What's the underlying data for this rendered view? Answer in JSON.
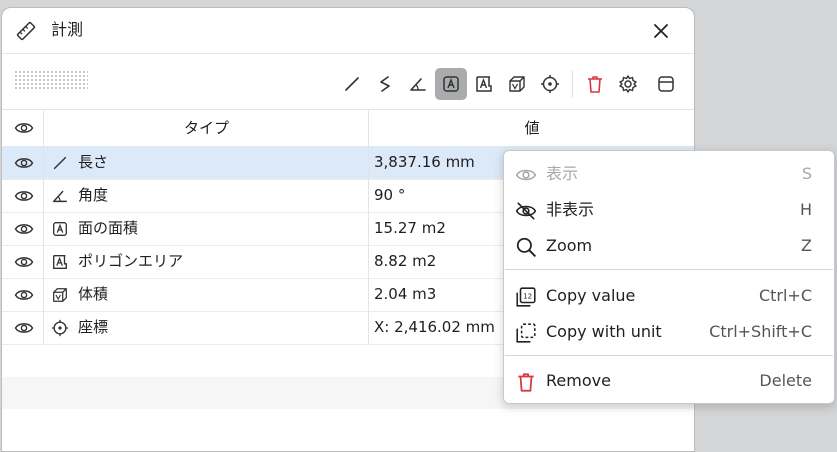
{
  "window": {
    "title": "計測",
    "close_icon": "close-icon"
  },
  "toolbar": {
    "tools": [
      {
        "name": "length-tool",
        "icon": "length-icon"
      },
      {
        "name": "polyline-tool",
        "icon": "polyline-icon"
      },
      {
        "name": "angle-tool",
        "icon": "angle-icon"
      },
      {
        "name": "face-area-tool",
        "icon": "area-icon",
        "active": true
      },
      {
        "name": "polygon-area-tool",
        "icon": "polygon-area-icon"
      },
      {
        "name": "volume-tool",
        "icon": "volume-icon"
      },
      {
        "name": "coordinate-tool",
        "icon": "coordinate-icon"
      },
      {
        "name": "delete-tool",
        "icon": "trash-icon"
      },
      {
        "name": "settings-tool",
        "icon": "gear-icon"
      },
      {
        "name": "panel-toggle-tool",
        "icon": "panel-icon"
      }
    ]
  },
  "table": {
    "headers": {
      "visibility": "eye-icon",
      "type": "タイプ",
      "value": "値"
    },
    "rows": [
      {
        "type": "長さ",
        "icon": "length-icon",
        "value": "3,837.16 mm",
        "selected": true
      },
      {
        "type": "角度",
        "icon": "angle-icon",
        "value": "90 °"
      },
      {
        "type": "面の面積",
        "icon": "area-icon",
        "value": "15.27 m2"
      },
      {
        "type": "ポリゴンエリア",
        "icon": "polygon-area-icon",
        "value": "8.82 m2"
      },
      {
        "type": "体積",
        "icon": "volume-icon",
        "value": "2.04 m3"
      },
      {
        "type": "座標",
        "icon": "coordinate-icon",
        "value": "X: 2,416.02 mm"
      }
    ]
  },
  "context_menu": {
    "items": [
      {
        "label": "表示",
        "shortcut": "S",
        "icon": "eye-icon",
        "disabled": true
      },
      {
        "label": "非表示",
        "shortcut": "H",
        "icon": "eye-off-icon"
      },
      {
        "label": "Zoom",
        "shortcut": "Z",
        "icon": "search-icon"
      },
      {
        "label": "Copy value",
        "shortcut": "Ctrl+C",
        "icon": "copy-value-icon"
      },
      {
        "label": "Copy with unit",
        "shortcut": "Ctrl+Shift+C",
        "icon": "copy-unit-icon"
      },
      {
        "label": "Remove",
        "shortcut": "Delete",
        "icon": "trash-icon"
      }
    ]
  },
  "colors": {
    "accent": "#dce9f8",
    "danger": "#d9363e",
    "active_tool": "#a9abad"
  }
}
